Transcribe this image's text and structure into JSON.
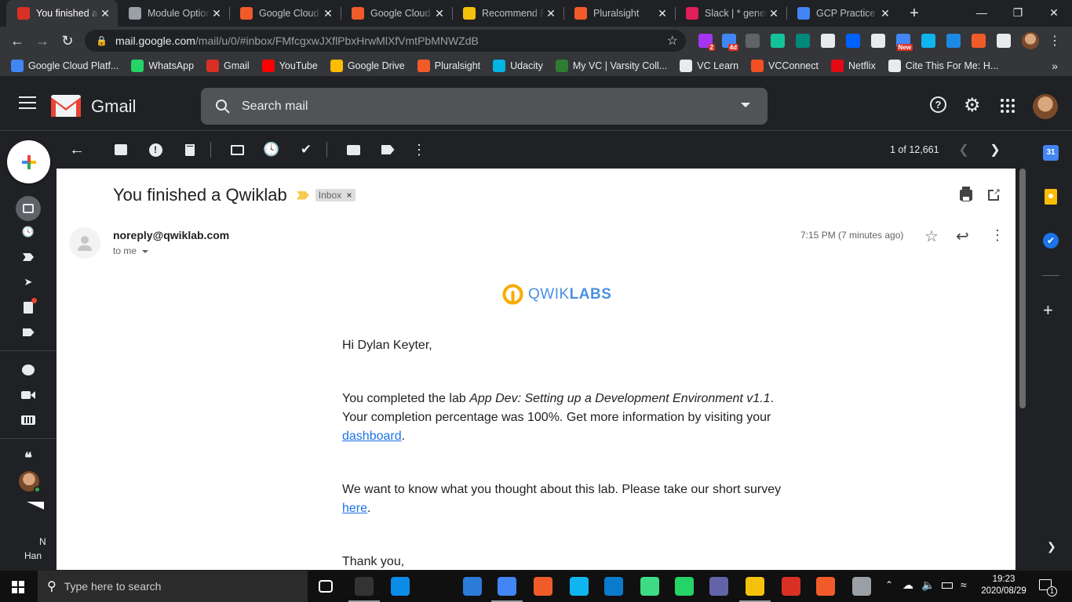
{
  "browser": {
    "tabs": [
      {
        "title": "You finished a Qwiklab",
        "icon": "gmail-icon",
        "color": "#d93025",
        "active": true
      },
      {
        "title": "Module Options",
        "icon": "globe-icon",
        "color": "#9aa0a6"
      },
      {
        "title": "Google Cloud",
        "icon": "pluralsight-icon",
        "color": "#f15b2a"
      },
      {
        "title": "Google Cloud",
        "icon": "pluralsight-icon",
        "color": "#f15b2a"
      },
      {
        "title": "Recommend P",
        "icon": "qwiklabs-icon",
        "color": "#f4c20d"
      },
      {
        "title": "Pluralsight",
        "icon": "pluralsight-icon",
        "color": "#f15b2a"
      },
      {
        "title": "Slack | * general",
        "icon": "slack-icon",
        "color": "#e01e5a"
      },
      {
        "title": "GCP Practice P",
        "icon": "docs-icon",
        "color": "#4285f4"
      }
    ],
    "new_tab": "+",
    "url_host": "mail.google.com",
    "url_path": "/mail/u/0/#inbox/FMfcgxwJXflPbxHrwMlXfVmtPbMNWZdB",
    "bookmarks": [
      {
        "label": "Google Cloud Platf...",
        "color": "#4285f4"
      },
      {
        "label": "WhatsApp",
        "color": "#25d366"
      },
      {
        "label": "Gmail",
        "color": "#d93025"
      },
      {
        "label": "YouTube",
        "color": "#ff0000"
      },
      {
        "label": "Google Drive",
        "color": "#fbbc04"
      },
      {
        "label": "Pluralsight",
        "color": "#f15b2a"
      },
      {
        "label": "Udacity",
        "color": "#02b3e4"
      },
      {
        "label": "My VC | Varsity Coll...",
        "color": "#2e7d32"
      },
      {
        "label": "VC Learn",
        "color": "#e8eaed"
      },
      {
        "label": "VCConnect",
        "color": "#f25022"
      },
      {
        "label": "Netflix",
        "color": "#e50914"
      },
      {
        "label": "Cite This For Me: H...",
        "color": "#e8eaed"
      }
    ],
    "bookmarks_more": "»",
    "ext_badges": {
      "ud": "2",
      "4d": "4d",
      "new": "New"
    }
  },
  "gmail": {
    "brand": "Gmail",
    "search_placeholder": "Search mail",
    "pagination": "1 of 12,661",
    "subject": "You finished a Qwiklab",
    "label_chip": "Inbox",
    "label_remove": "×",
    "sender": "noreply@qwiklab.com",
    "to": "to me",
    "timestamp": "7:15 PM (7 minutes ago)",
    "body": {
      "logo_prefix": "QWIK",
      "logo_suffix": "LABS",
      "greeting": "Hi Dylan Keyter,",
      "p1_before": "You completed the lab ",
      "p1_lab": "App Dev: Setting up a Development Environment v1.1",
      "p1_after": ". Your completion percentage was 100%. Get more information by visiting your ",
      "p1_link": "dashboard",
      "p1_end": ".",
      "p2_before": "We want to know what you thought about this lab. Please take our short survey ",
      "p2_link": "here",
      "p2_end": ".",
      "signoff": "Thank you,"
    },
    "rail_truncated_1": "N",
    "rail_truncated_2": "Han"
  },
  "taskbar": {
    "search_placeholder": "Type here to search",
    "time": "19:23",
    "date": "2020/08/29",
    "notifications": "1"
  },
  "colors": {
    "gmail_red": "#ea4335",
    "qwik_yellow": "#f9ab00",
    "qwik_blue": "#4a90e2",
    "link_blue": "#1a73e8"
  }
}
